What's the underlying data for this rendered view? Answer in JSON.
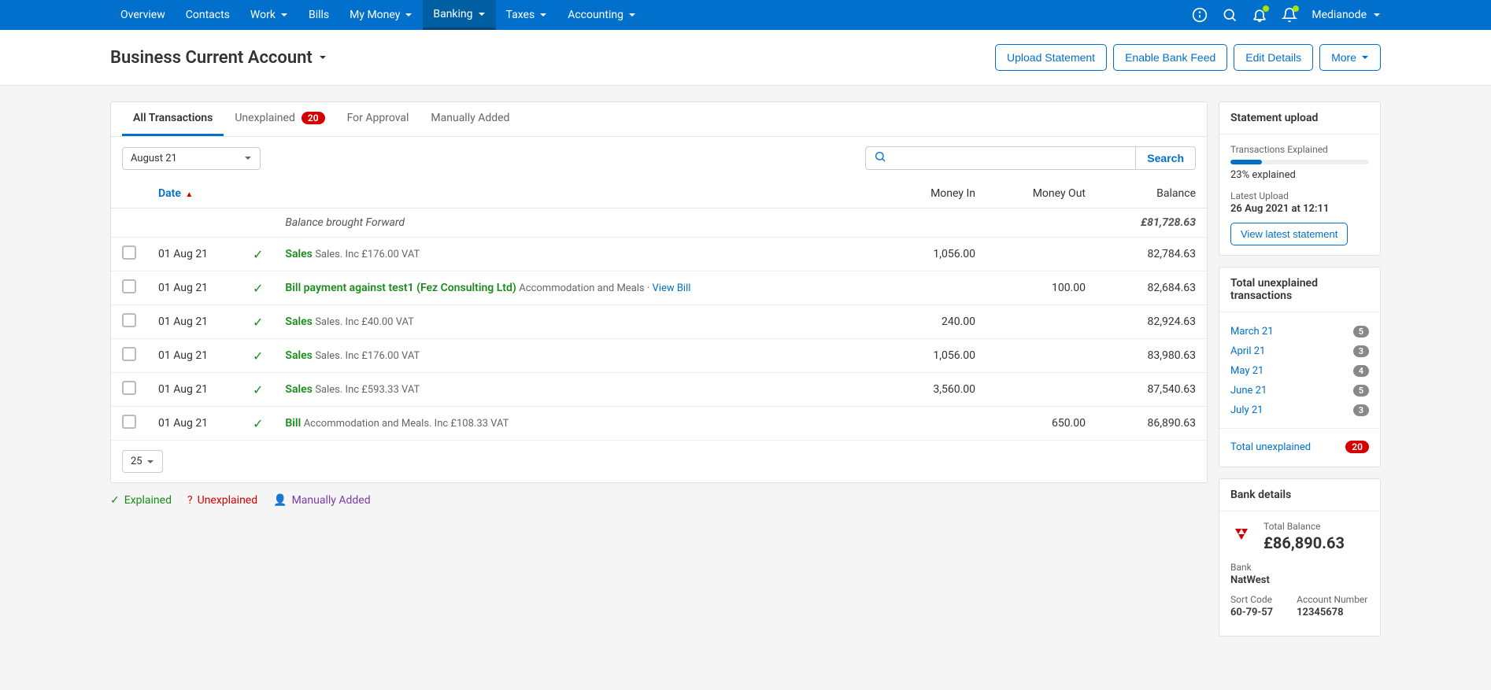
{
  "nav": {
    "items": [
      {
        "label": "Overview",
        "dropdown": false
      },
      {
        "label": "Contacts",
        "dropdown": false
      },
      {
        "label": "Work",
        "dropdown": true
      },
      {
        "label": "Bills",
        "dropdown": false
      },
      {
        "label": "My Money",
        "dropdown": true
      },
      {
        "label": "Banking",
        "dropdown": true,
        "active": true
      },
      {
        "label": "Taxes",
        "dropdown": true
      },
      {
        "label": "Accounting",
        "dropdown": true
      }
    ],
    "user": "Medianode"
  },
  "page": {
    "title": "Business Current Account",
    "actions": {
      "upload_statement": "Upload Statement",
      "enable_feed": "Enable Bank Feed",
      "edit_details": "Edit Details",
      "more": "More"
    }
  },
  "tabs": [
    {
      "label": "All Transactions",
      "active": true
    },
    {
      "label": "Unexplained",
      "badge": "20"
    },
    {
      "label": "For Approval"
    },
    {
      "label": "Manually Added"
    }
  ],
  "filter": {
    "month": "August 21",
    "search_label": "Search"
  },
  "table": {
    "headers": {
      "date": "Date",
      "money_in": "Money In",
      "money_out": "Money Out",
      "balance": "Balance"
    },
    "balance_forward_label": "Balance brought Forward",
    "balance_forward_amount": "£81,728.63",
    "rows": [
      {
        "date": "01 Aug 21",
        "type": "Sales",
        "desc": "Sales. Inc £176.00 VAT",
        "in": "1,056.00",
        "out": "",
        "balance": "82,784.63"
      },
      {
        "date": "01 Aug 21",
        "type": "Bill payment against test1 (Fez Consulting Ltd)",
        "desc": "Accommodation and Meals · ",
        "link": "View Bill",
        "in": "",
        "out": "100.00",
        "balance": "82,684.63"
      },
      {
        "date": "01 Aug 21",
        "type": "Sales",
        "desc": "Sales. Inc £40.00 VAT",
        "in": "240.00",
        "out": "",
        "balance": "82,924.63"
      },
      {
        "date": "01 Aug 21",
        "type": "Sales",
        "desc": "Sales. Inc £176.00 VAT",
        "in": "1,056.00",
        "out": "",
        "balance": "83,980.63"
      },
      {
        "date": "01 Aug 21",
        "type": "Sales",
        "desc": "Sales. Inc £593.33 VAT",
        "in": "3,560.00",
        "out": "",
        "balance": "87,540.63"
      },
      {
        "date": "01 Aug 21",
        "type": "Bill",
        "desc": "Accommodation and Meals. Inc £108.33 VAT",
        "in": "",
        "out": "650.00",
        "balance": "86,890.63"
      }
    ],
    "page_size": "25"
  },
  "legend": {
    "explained": "Explained",
    "unexplained": "Unexplained",
    "manually_added": "Manually Added"
  },
  "sidebar": {
    "statement_upload": {
      "title": "Statement upload",
      "explained_label": "Transactions Explained",
      "progress_pct": 23,
      "explained_text": "23% explained",
      "latest_upload_label": "Latest Upload",
      "latest_upload_value": "26 Aug 2021 at 12:11",
      "view_statement_btn": "View latest statement"
    },
    "unexplained": {
      "title": "Total unexplained transactions",
      "rows": [
        {
          "label": "March 21",
          "count": "5"
        },
        {
          "label": "April 21",
          "count": "3"
        },
        {
          "label": "May 21",
          "count": "4"
        },
        {
          "label": "June 21",
          "count": "5"
        },
        {
          "label": "July 21",
          "count": "3"
        }
      ],
      "total_label": "Total unexplained",
      "total_count": "20"
    },
    "bank_details": {
      "title": "Bank details",
      "total_balance_label": "Total Balance",
      "total_balance": "£86,890.63",
      "bank_label": "Bank",
      "bank_name": "NatWest",
      "sort_code_label": "Sort Code",
      "sort_code": "60-79-57",
      "acct_num_label": "Account Number",
      "acct_num": "12345678"
    }
  }
}
